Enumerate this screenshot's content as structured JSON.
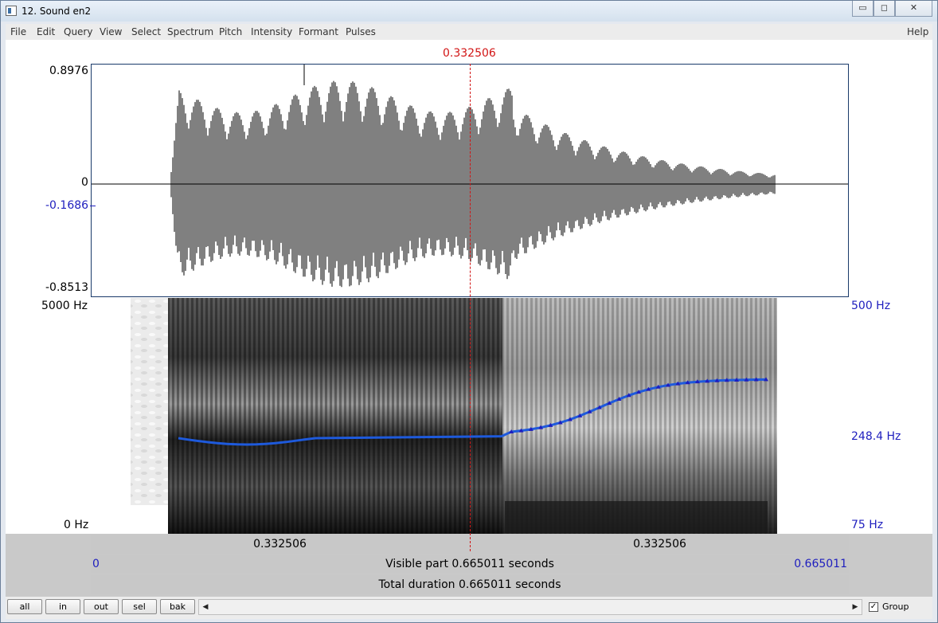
{
  "window": {
    "title": "12. Sound en2",
    "controls": {
      "minimize": "▭",
      "maximize": "◻",
      "close": "✕"
    }
  },
  "menu": [
    "File",
    "Edit",
    "Query",
    "View",
    "Select",
    "Spectrum",
    "Pitch",
    "Intensity",
    "Formant",
    "Pulses"
  ],
  "help_label": "Help",
  "cursor_time": "0.332506",
  "waveform": {
    "max_label": "0.8976",
    "zero_label": "0",
    "cursor_value_label": "-0.1686",
    "min_label": "-0.8513"
  },
  "spectrogram": {
    "top_freq": "5000 Hz",
    "bottom_freq": "0 Hz",
    "pitch_top": "500 Hz",
    "pitch_mid": "248.4 Hz",
    "pitch_bottom": "75 Hz",
    "pitch_color": "#1e5adc"
  },
  "time_bar": {
    "left_segment": "0.332506",
    "right_segment": "0.332506",
    "start": "0",
    "end": "0.665011",
    "visible": "Visible part 0.665011 seconds",
    "total": "Total duration 0.665011 seconds"
  },
  "buttons": [
    "all",
    "in",
    "out",
    "sel",
    "bak"
  ],
  "scroll": {
    "left_arrow": "◀",
    "right_arrow": "▶"
  },
  "group": {
    "label": "Group",
    "checked": true,
    "mark": "✓"
  }
}
